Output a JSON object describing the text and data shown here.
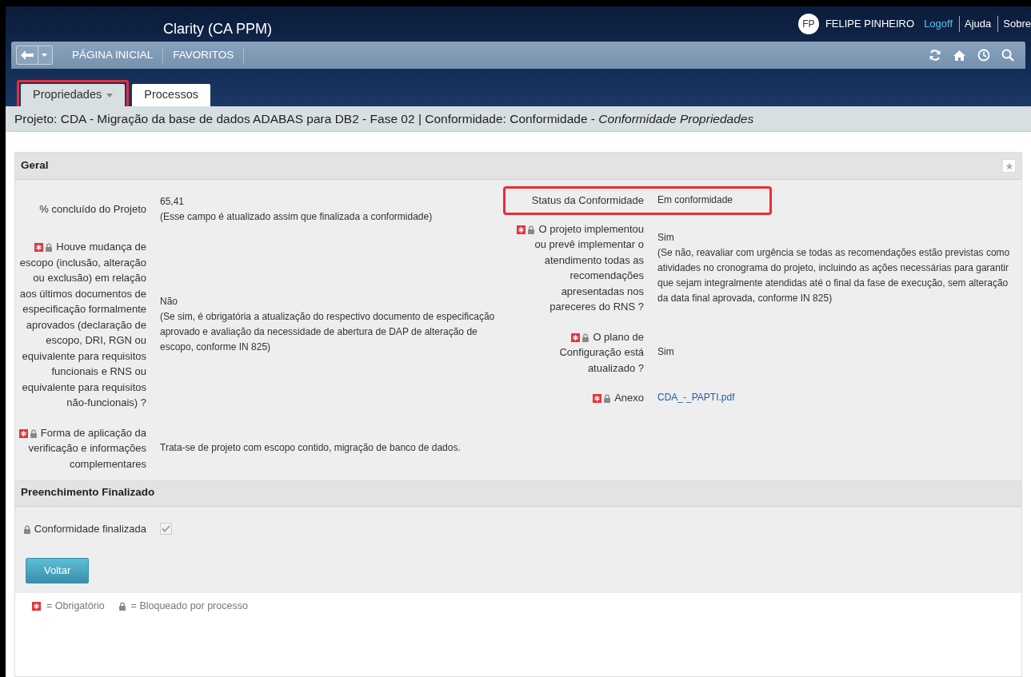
{
  "header": {
    "title": "Clarity (CA PPM)",
    "user": {
      "initials": "FP",
      "name": "FELIPE PINHEIRO"
    },
    "links": [
      {
        "label": "Logoff",
        "kind": "link"
      },
      {
        "label": "Ajuda",
        "kind": "plain"
      },
      {
        "label": "Sobre",
        "kind": "plain"
      }
    ]
  },
  "nav": {
    "items": [
      "PÁGINA INICIAL",
      "FAVORITOS"
    ]
  },
  "tabs": [
    {
      "label": "Propriedades",
      "selected": true,
      "dropdown": true,
      "highlighted": true
    },
    {
      "label": "Processos",
      "selected": false,
      "dropdown": false,
      "highlighted": false
    }
  ],
  "breadcrumb": "Projeto: CDA - Migração da base de dados ADABAS para DB2 - Fase 02 | Conformidade: Conformidade - *Conformidade Propriedades*",
  "sections": [
    {
      "title": "Geral",
      "columns": [
        [
          {
            "label": "% concluído do Projeto",
            "required": false,
            "locked": false,
            "kind": "text",
            "value": "65,41",
            "note": "(Esse campo é atualizado assim que finalizada a conformidade)",
            "highlighted": false
          },
          {
            "label": "Houve mudança de escopo (inclusão, alteração ou exclusão) em relação aos últimos documentos de especificação formalmente aprovados (declaração de escopo, DRI, RGN ou equivalente para requisitos funcionais e RNS ou equivalente para requisitos não-funcionais) ?",
            "required": true,
            "locked": true,
            "kind": "text",
            "value": "Não",
            "note": "(Se sim, é obrigatória a atualização do respectivo documento de especificação aprovado e avaliação da necessidade de abertura de DAP de alteração de escopo, conforme IN 825)",
            "highlighted": false
          },
          {
            "label": "Forma de aplicação da verificação e informações complementares",
            "required": true,
            "locked": true,
            "kind": "text",
            "value": "Trata-se de projeto com escopo contido, migração de banco de dados.",
            "highlighted": false
          }
        ],
        [
          {
            "label": "Status da Conformidade",
            "required": false,
            "locked": false,
            "kind": "text",
            "value": "Em conformidade",
            "highlighted": true
          },
          {
            "label": "O projeto implementou ou prevê implementar o atendimento todas as recomendações apresentadas nos pareceres do RNS ?",
            "required": true,
            "locked": true,
            "kind": "text",
            "value": "Sim",
            "note": "(Se não, reavaliar com urgência se todas as recomendações estão previstas como atividades no cronograma do projeto, incluindo as ações necessárias para garantir que sejam integralmente atendidas até o final da fase de execução, sem alteração da data final aprovada, conforme IN 825)",
            "highlighted": false
          },
          {
            "label": "O plano de Configuração está atualizado ?",
            "required": true,
            "locked": true,
            "kind": "text",
            "value": "Sim",
            "highlighted": false
          },
          {
            "label": "Anexo",
            "required": true,
            "locked": true,
            "kind": "link",
            "value": "CDA_-_PAPTI.pdf",
            "highlighted": false
          }
        ]
      ]
    },
    {
      "title": "Preenchimento Finalizado",
      "columns": [
        [
          {
            "label": "Conformidade finalizada",
            "required": false,
            "locked": true,
            "kind": "checkbox",
            "checked": true,
            "disabled": true,
            "highlighted": false
          }
        ]
      ]
    }
  ],
  "button": "Voltar",
  "legend": [
    {
      "kind": "required",
      "text": "= Obrigatório"
    },
    {
      "kind": "locked",
      "text": "= Bloqueado por processo"
    }
  ]
}
